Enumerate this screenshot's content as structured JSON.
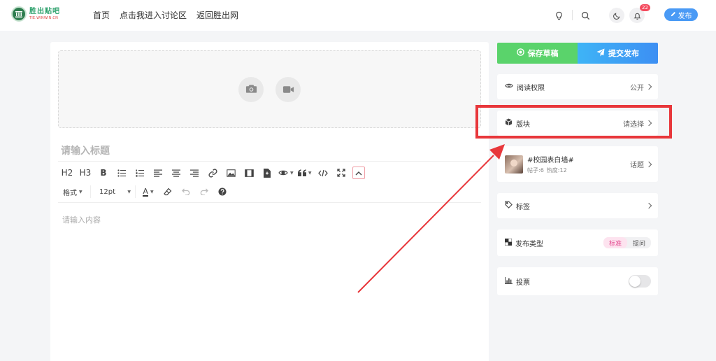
{
  "header": {
    "logo_text": "胜出贴吧",
    "logo_sub": "TIE.WINWIN.CN",
    "nav": [
      "首页",
      "点击我进入讨论区",
      "返回胜出网"
    ],
    "notification_count": "22",
    "publish_label": "发布"
  },
  "editor": {
    "title_placeholder": "请输入标题",
    "toolbar": {
      "h2": "H2",
      "h3": "H3",
      "bold": "B",
      "format_select": "格式",
      "fontsize_select": "12pt",
      "font_color": "A"
    },
    "content_placeholder": "请输入内容"
  },
  "sidebar": {
    "save_draft": "保存草稿",
    "submit": "提交发布",
    "read_permission": {
      "label": "阅读权限",
      "value": "公开"
    },
    "board": {
      "label": "版块",
      "value": "请选择"
    },
    "topic": {
      "name": "#校园表白墙#",
      "posts": "帖子:6",
      "heat": "热度:12",
      "action": "话题"
    },
    "tags": {
      "label": "标签"
    },
    "post_type": {
      "label": "发布类型",
      "options": [
        "标准",
        "提问"
      ],
      "selected": "标准"
    },
    "vote": {
      "label": "投票",
      "enabled": false
    }
  },
  "colors": {
    "accent_green": "#5ad36b",
    "accent_blue": "#3d8ff3",
    "annotation_red": "#e8373b",
    "badge_red": "#f44b5e",
    "pink": "#e44f93"
  }
}
